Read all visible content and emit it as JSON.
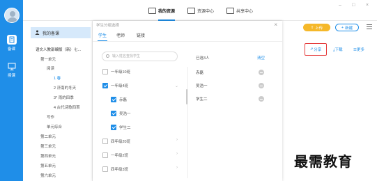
{
  "nav_tabs": [
    {
      "label": "我的资源",
      "active": true
    },
    {
      "label": "资源中心",
      "active": false
    },
    {
      "label": "共享中心",
      "active": false
    }
  ],
  "window_controls": [
    "–",
    "□",
    "×"
  ],
  "rail": {
    "items": [
      {
        "label": "备课",
        "icon": "document-icon",
        "active": true
      },
      {
        "label": "授课",
        "icon": "teach-icon",
        "active": false
      }
    ]
  },
  "tree": {
    "my_lessons": "我的备课",
    "root": "语文人教部编版（新）七...",
    "rows": [
      "第一单元",
      "阅读",
      "1 春",
      "2 济南的冬天",
      "3* 雨的四季",
      "4 古代诗歌四首",
      "写作",
      "单元综合",
      "第二单元",
      "第三单元",
      "第四单元",
      "第五单元",
      "第六单元"
    ]
  },
  "dialog": {
    "title": "学生分组选择",
    "tabs": [
      "学生",
      "老师",
      "链接"
    ],
    "search_placeholder": "输入姓名查找学生",
    "groups": [
      {
        "label": "一年级10班",
        "checked": false
      },
      {
        "label": "一年级4班",
        "checked": true
      },
      {
        "label": "赤磊",
        "checked": true
      },
      {
        "label": "吴浩一",
        "checked": true
      },
      {
        "label": "学生二",
        "checked": true
      },
      {
        "label": "四年级20班",
        "checked": false
      },
      {
        "label": "一年级2班",
        "checked": false
      },
      {
        "label": "四年级3班",
        "checked": false
      }
    ],
    "selected_header": "已选3人",
    "clear_label": "清空",
    "selected": [
      "赤磊",
      "吴浩一",
      "学生二"
    ]
  },
  "actions": {
    "upload": "上传",
    "new": "新建",
    "share": "分享",
    "download": "下载",
    "more": "更多"
  },
  "watermark": "最需教育",
  "colors": {
    "primary": "#1f8ee8",
    "upload": "#f5b82a",
    "highlight": "#e53b3b"
  }
}
